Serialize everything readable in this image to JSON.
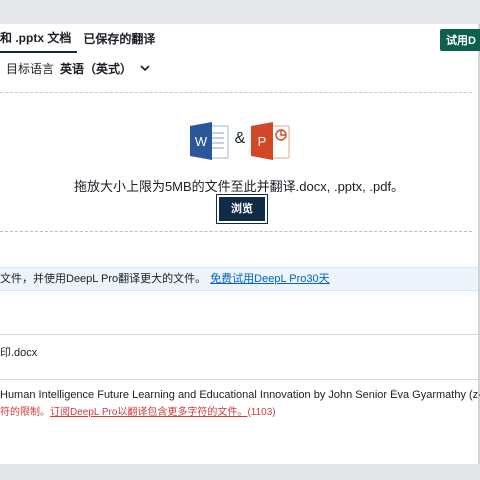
{
  "tabs": [
    {
      "label": "和 .pptx 文档",
      "active": true
    },
    {
      "label": "已保存的翻译",
      "active": false
    }
  ],
  "trial_badge": "试用D",
  "target_language": {
    "label": "目标语言",
    "value": "英语（英式）",
    "icon": "chevron-down-icon"
  },
  "dropzone": {
    "icons": [
      "word-icon",
      "powerpoint-icon"
    ],
    "ampersand": "&",
    "instruction": "拖放大小上限为5MB的文件至此并翻译.docx, .pptx, .pdf。",
    "browse_label": "浏览"
  },
  "info_banner": {
    "text": "文件，并使用DeepL Pro翻译更大的文件。",
    "link": "免费试用DeepL Pro30天"
  },
  "file": {
    "name": "印.docx"
  },
  "document": {
    "title": "Human Intelligence Future Learning and Educational Innovation by John Senior  Éva Gyarmathy (z-lib.",
    "warning_prefix": "符的限制。",
    "warning_link": "订阅DeepL Pro以翻译包含更多字符的文件。",
    "warning_count": "(1103)"
  },
  "colors": {
    "navy": "#0f2b46",
    "teal_badge": "#0f5f4f",
    "link_blue": "#0062cc",
    "warning_red": "#d23b3b",
    "word_blue": "#2b579a",
    "ppt_orange": "#d24726"
  }
}
